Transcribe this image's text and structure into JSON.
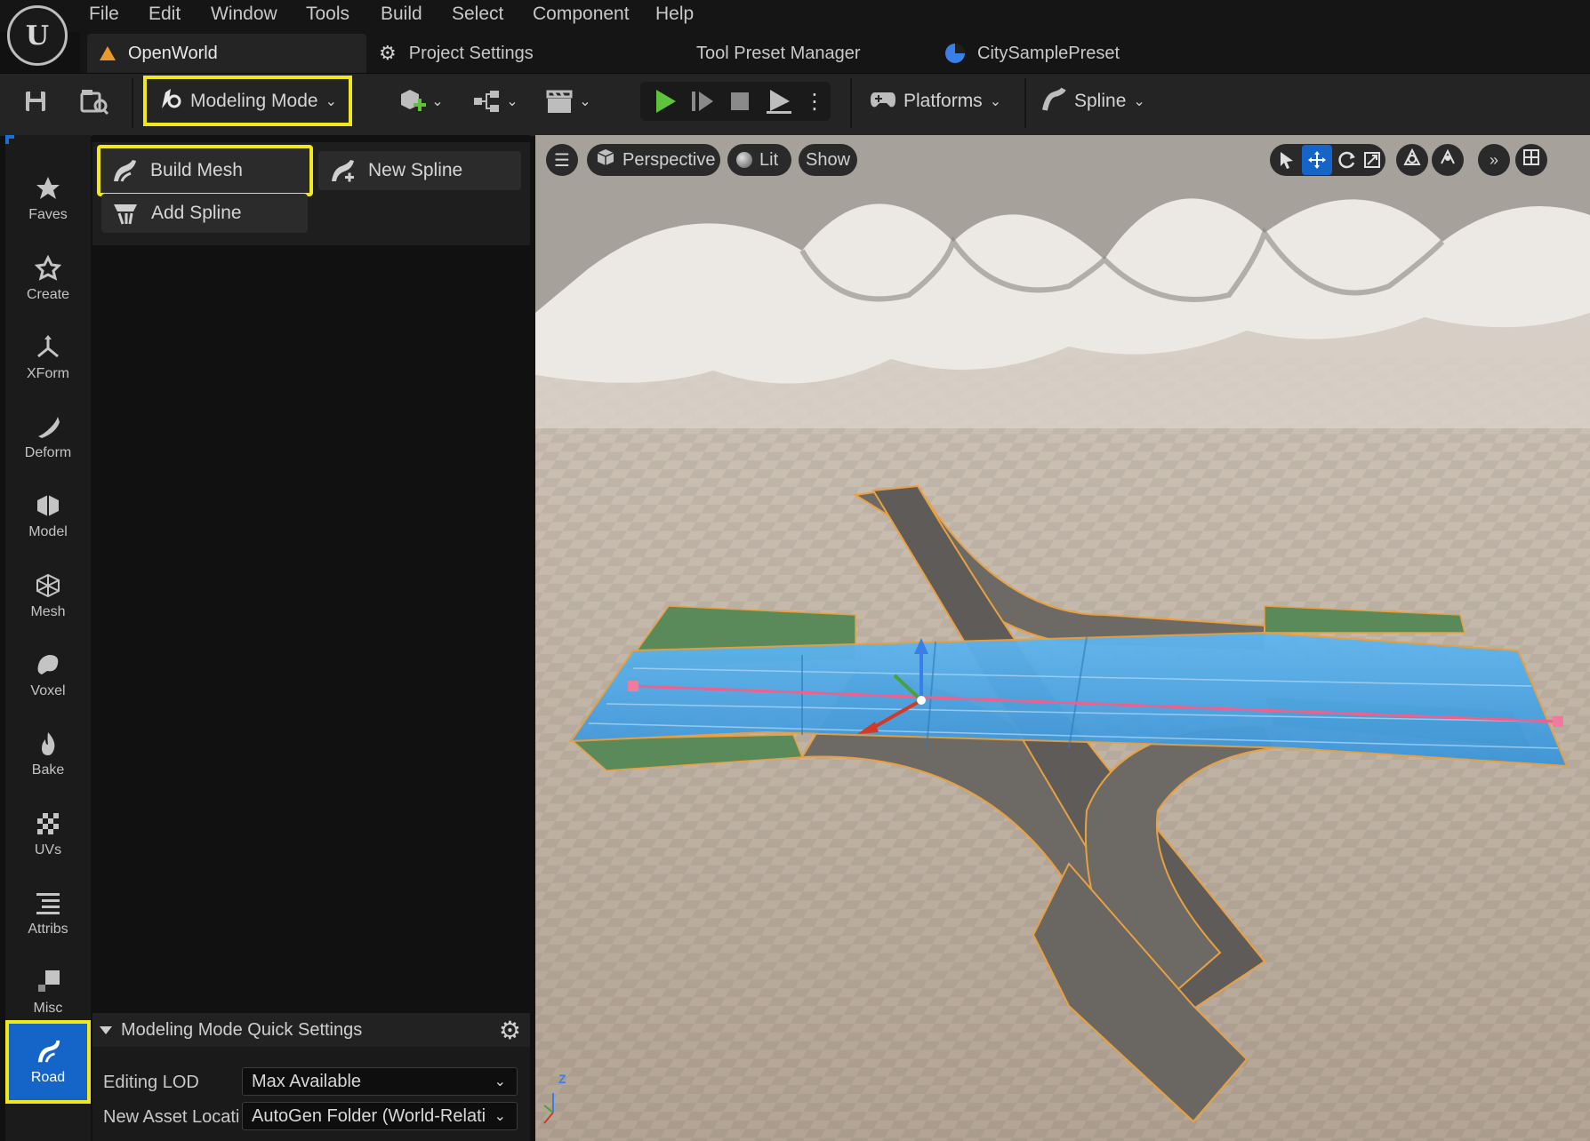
{
  "menu": {
    "items": [
      "File",
      "Edit",
      "Window",
      "Tools",
      "Build",
      "Select",
      "Component",
      "Help"
    ]
  },
  "tabs": {
    "openworld": "OpenWorld",
    "project_settings": "Project Settings",
    "tool_preset_manager": "Tool Preset Manager",
    "city_sample_preset": "CitySamplePreset"
  },
  "toolbar": {
    "mode_label": "Modeling Mode",
    "platforms_label": "Platforms",
    "spline_label": "Spline"
  },
  "categories": [
    {
      "label": "Faves",
      "icon": "star-icon"
    },
    {
      "label": "Create",
      "icon": "create-icon"
    },
    {
      "label": "XForm",
      "icon": "transform-icon"
    },
    {
      "label": "Deform",
      "icon": "deform-icon"
    },
    {
      "label": "Model",
      "icon": "model-icon"
    },
    {
      "label": "Mesh",
      "icon": "mesh-icon"
    },
    {
      "label": "Voxel",
      "icon": "voxel-icon"
    },
    {
      "label": "Bake",
      "icon": "bake-icon"
    },
    {
      "label": "UVs",
      "icon": "uvs-icon"
    },
    {
      "label": "Attribs",
      "icon": "attribs-icon"
    },
    {
      "label": "Misc",
      "icon": "misc-icon"
    },
    {
      "label": "Road",
      "icon": "road-icon",
      "selected": true
    }
  ],
  "tools": {
    "build_mesh": "Build Mesh",
    "new_spline": "New Spline",
    "add_spline": "Add Spline"
  },
  "quick_settings": {
    "title": "Modeling Mode Quick Settings",
    "editing_lod_label": "Editing LOD",
    "editing_lod_value": "Max Available",
    "new_asset_label": "New Asset Locati",
    "new_asset_value": "AutoGen Folder (World-Relati"
  },
  "viewport": {
    "perspective_label": "Perspective",
    "lit_label": "Lit",
    "show_label": "Show",
    "axis_z": "Z"
  },
  "colors": {
    "highlight": "#f0e81c",
    "selected_category": "#1565c8",
    "play_green": "#5fc23a",
    "road_blue": "#4aa8e8",
    "spline_pink": "#f0608a",
    "ground": "#bfb1a2"
  }
}
